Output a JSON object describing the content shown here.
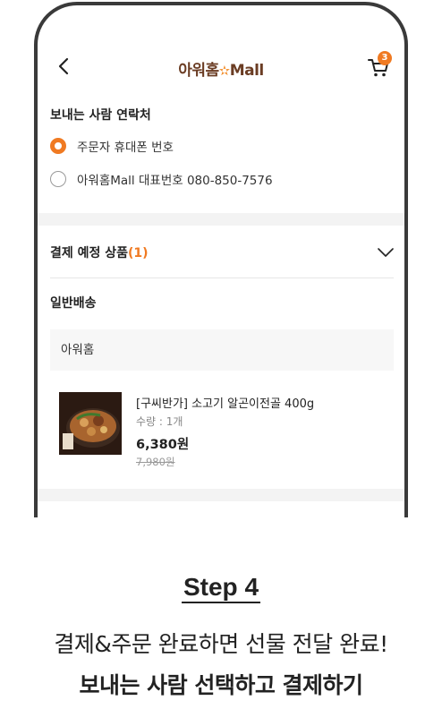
{
  "header": {
    "logo_text": "아워홈",
    "logo_suffix": "Mall",
    "cart_count": "3"
  },
  "sender_contact": {
    "title": "보내는 사람 연락처",
    "options": [
      {
        "label": "주문자 휴대폰 번호",
        "selected": true
      },
      {
        "label": "아워홈Mall 대표번호 080-850-7576",
        "selected": false
      }
    ]
  },
  "order": {
    "label": "결제 예정 상품",
    "count": "(1)",
    "shipping_type": "일반배송",
    "seller": "아워홈",
    "product": {
      "name": "[구씨반가] 소고기 알곤이전골 400g",
      "quantity": "수량 : 1개",
      "price": "6,380원",
      "original_price": "7,980원"
    }
  },
  "caption": {
    "step": "Step 4",
    "line1": "결제&주문 완료하면 선물 전달 완료!",
    "line2": "보내는 사람 선택하고 결제하기"
  },
  "colors": {
    "accent": "#f07a22",
    "brand": "#6b3d24"
  }
}
